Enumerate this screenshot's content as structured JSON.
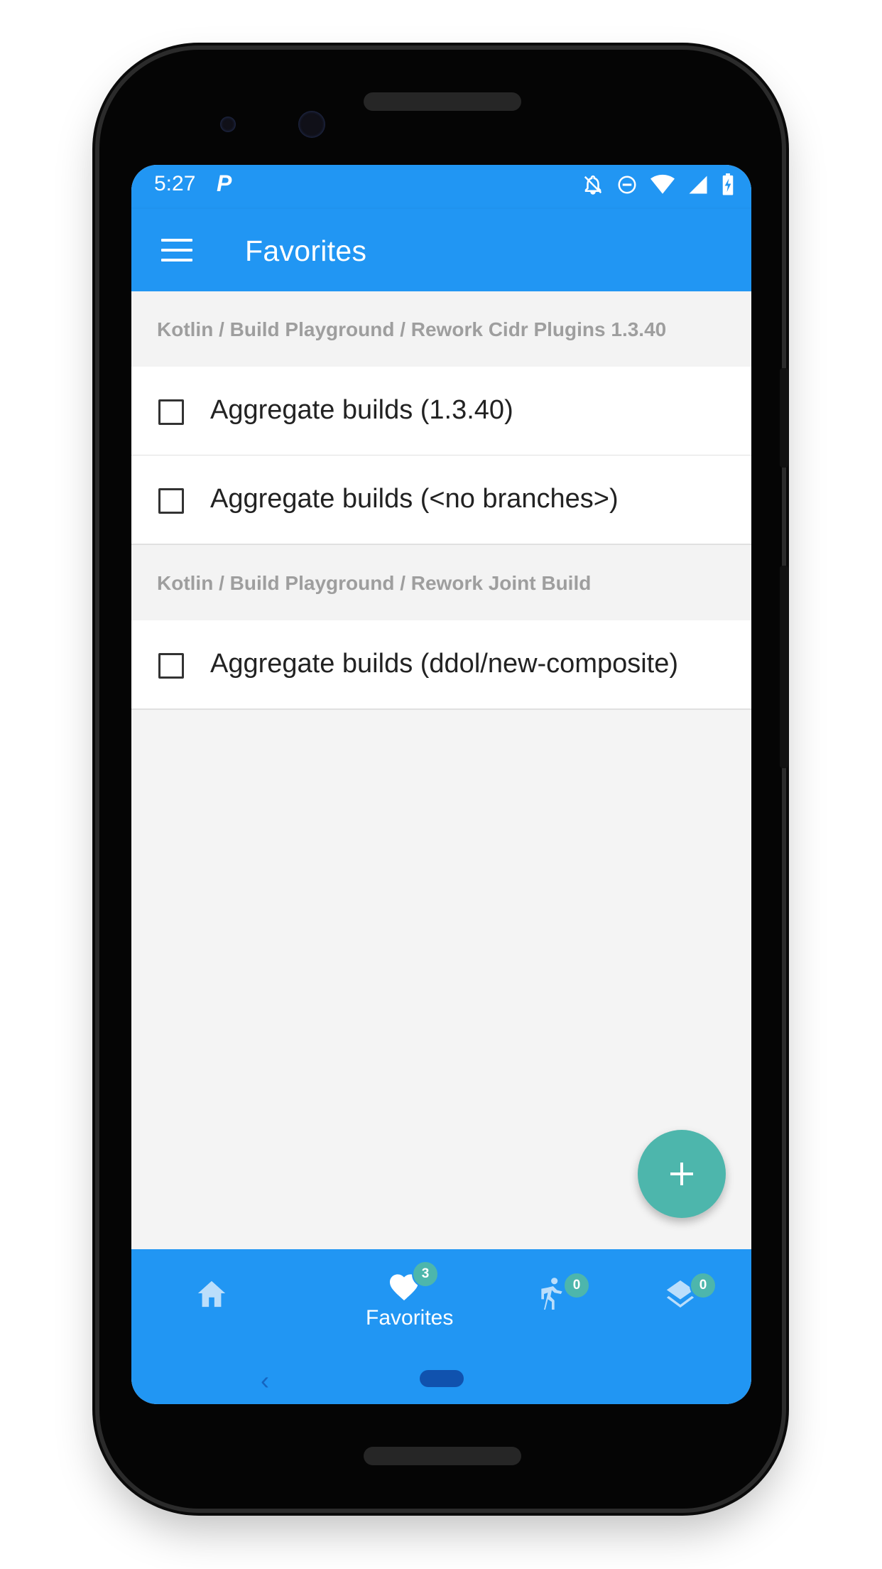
{
  "status_bar": {
    "time": "5:27",
    "app_glyph": "P",
    "icons": [
      "notifications-off-icon",
      "do-not-disturb-icon",
      "wifi-icon",
      "signal-icon",
      "battery-charging-icon"
    ]
  },
  "app_bar": {
    "title": "Favorites",
    "menu_icon": "menu-icon"
  },
  "sections": [
    {
      "header": "Kotlin / Build Playground / Rework Cidr Plugins 1.3.40",
      "items": [
        {
          "label": "Aggregate builds (1.3.40)",
          "checked": false
        },
        {
          "label": "Aggregate builds (<no branches>)",
          "checked": false
        }
      ]
    },
    {
      "header": "Kotlin / Build Playground / Rework Joint Build",
      "items": [
        {
          "label": "Aggregate builds (ddol/new-composite)",
          "checked": false
        }
      ]
    }
  ],
  "fab": {
    "icon": "plus-icon"
  },
  "bottom_nav": {
    "items": [
      {
        "id": "home",
        "icon": "home-icon",
        "label": "",
        "badge": ""
      },
      {
        "id": "favorites",
        "icon": "heart-icon",
        "label": "Favorites",
        "badge": "3"
      },
      {
        "id": "running",
        "icon": "running-icon",
        "label": "",
        "badge": "0"
      },
      {
        "id": "queue",
        "icon": "layers-icon",
        "label": "",
        "badge": "0"
      }
    ]
  },
  "colors": {
    "primary": "#2196f3",
    "accent": "#4db6ac",
    "background": "#f4f4f4"
  }
}
